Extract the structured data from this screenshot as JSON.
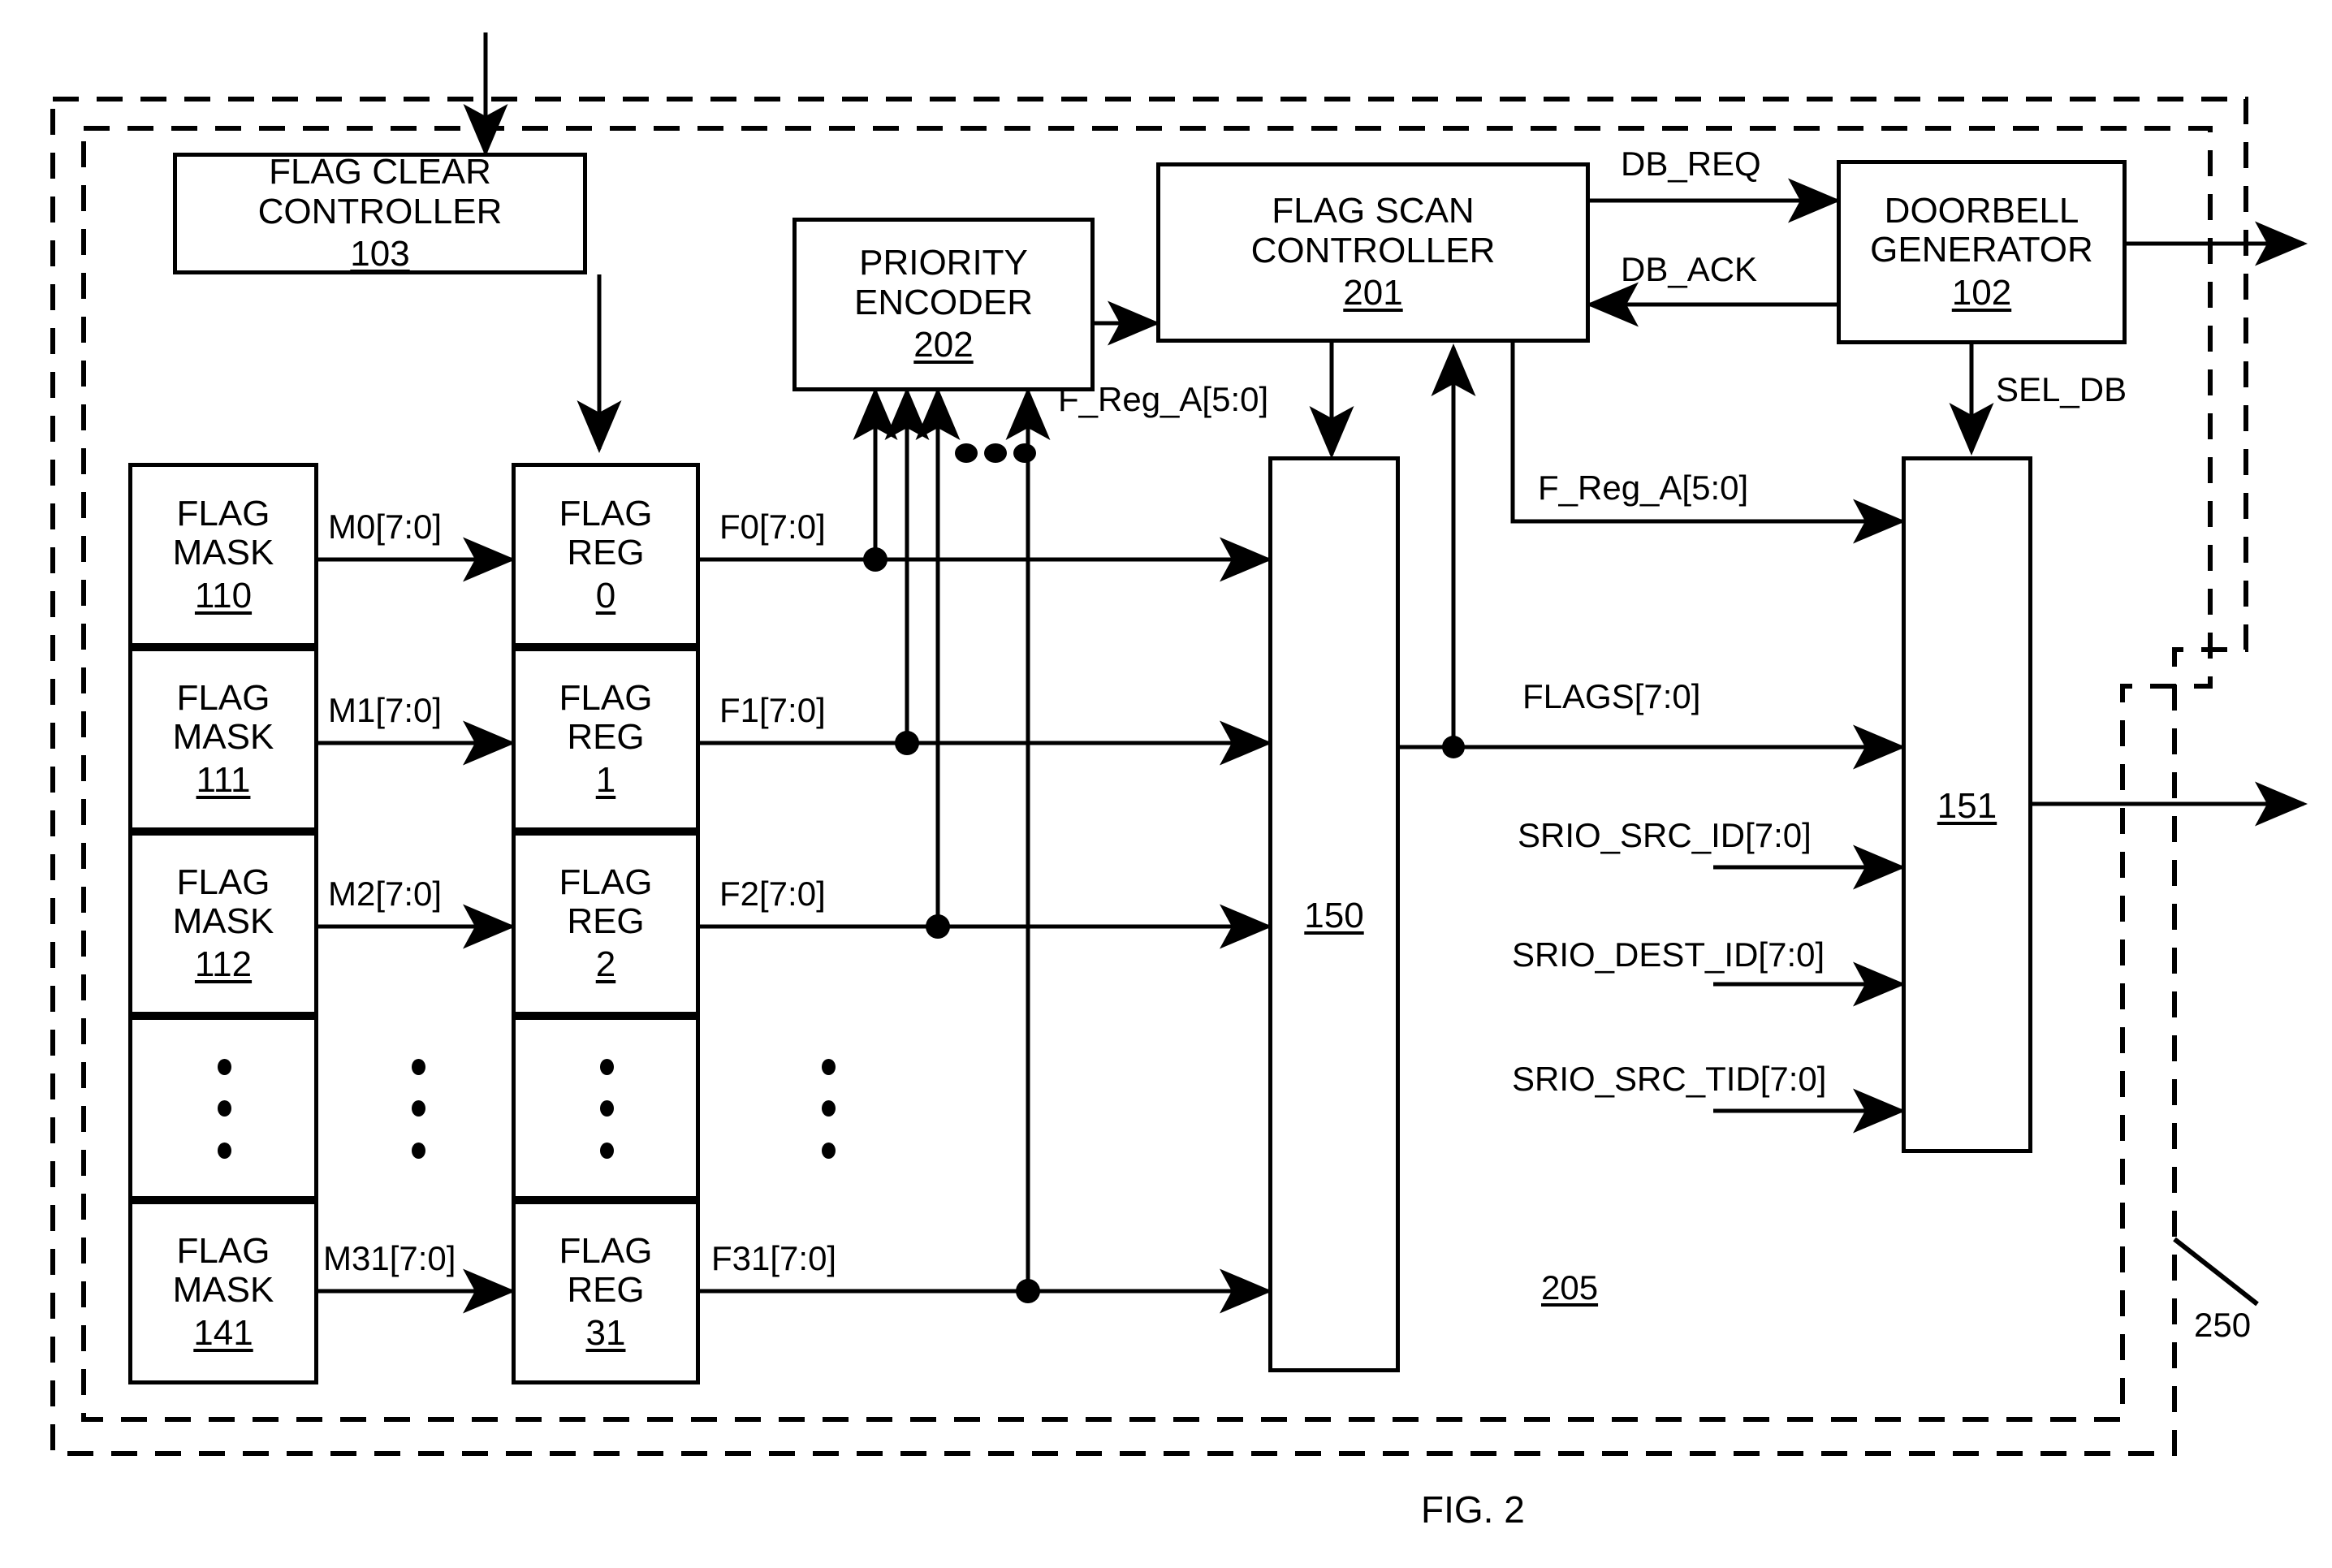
{
  "figure": {
    "caption": "FIG. 2",
    "outer_boundary_ref": "250",
    "inner_region_ref": "205"
  },
  "blocks": {
    "flag_clear_controller": {
      "title": "FLAG CLEAR CONTROLLER",
      "ref": "103"
    },
    "priority_encoder": {
      "title_line1": "PRIORITY",
      "title_line2": "ENCODER",
      "ref": "202"
    },
    "flag_scan_controller": {
      "title_line1": "FLAG SCAN",
      "title_line2": "CONTROLLER",
      "ref": "201"
    },
    "doorbell_generator": {
      "title_line1": "DOORBELL",
      "title_line2": "GENERATOR",
      "ref": "102"
    },
    "mux_150": {
      "ref": "150"
    },
    "mux_151": {
      "ref": "151"
    }
  },
  "flag_masks": [
    {
      "title_line1": "FLAG",
      "title_line2": "MASK",
      "ref": "110"
    },
    {
      "title_line1": "FLAG",
      "title_line2": "MASK",
      "ref": "111"
    },
    {
      "title_line1": "FLAG",
      "title_line2": "MASK",
      "ref": "112"
    },
    {
      "title_line1": "FLAG",
      "title_line2": "MASK",
      "ref": "141"
    }
  ],
  "flag_regs": [
    {
      "title_line1": "FLAG",
      "title_line2": "REG",
      "ref": "0"
    },
    {
      "title_line1": "FLAG",
      "title_line2": "REG",
      "ref": "1"
    },
    {
      "title_line1": "FLAG",
      "title_line2": "REG",
      "ref": "2"
    },
    {
      "title_line1": "FLAG",
      "title_line2": "REG",
      "ref": "31"
    }
  ],
  "mask_signals": [
    "M0[7:0]",
    "M1[7:0]",
    "M2[7:0]",
    "M31[7:0]"
  ],
  "flag_signals": [
    "F0[7:0]",
    "F1[7:0]",
    "F2[7:0]",
    "F31[7:0]"
  ],
  "signals": {
    "db_req": "DB_REQ",
    "db_ack": "DB_ACK",
    "sel_db": "SEL_DB",
    "f_reg_a_encoder": "F_Reg_A[5:0]",
    "f_reg_a_mux": "F_Reg_A[5:0]",
    "flags": "FLAGS[7:0]",
    "srio_src_id": "SRIO_SRC_ID[7:0]",
    "srio_dest_id": "SRIO_DEST_ID[7:0]",
    "srio_src_tid": "SRIO_SRC_TID[7:0]"
  },
  "colors": {
    "stroke": "#000000",
    "background": "#ffffff"
  }
}
